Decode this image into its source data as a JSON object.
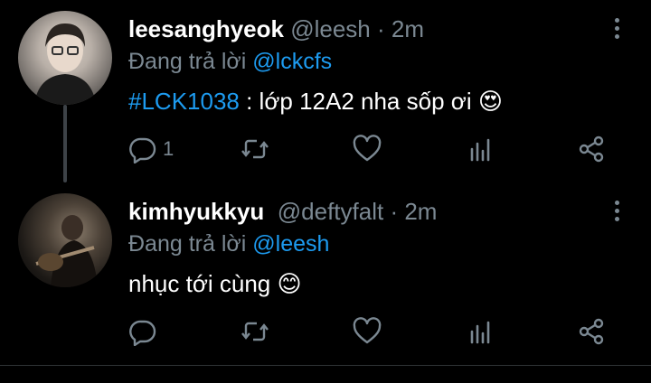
{
  "tweets": [
    {
      "display_name": "leesanghyeok",
      "handle": "@leesh",
      "separator": "·",
      "time": "2m",
      "reply_prefix": "Đang trả lời",
      "reply_to": "@lckcfs",
      "hashtag": "#LCK1038",
      "text": " : lớp 12A2 nha sốp ơi",
      "emoji": "😍",
      "reply_count": "1",
      "avatar_icon": "person-photo-avatar"
    },
    {
      "display_name": "kimhyukkyu",
      "handle": "@deftyfalt",
      "separator": "·",
      "time": "2m",
      "reply_prefix": "Đang trả lời",
      "reply_to": "@leesh",
      "text": "nhục tới cùng",
      "emoji": "😊",
      "reply_count": "",
      "avatar_icon": "guitarist-photo-avatar"
    }
  ],
  "colors": {
    "background": "#000000",
    "text": "#ffffff",
    "muted": "#7b8892",
    "accent": "#1d9bf0",
    "thread_line": "#3d4247"
  },
  "icons": [
    "reply-icon",
    "retweet-icon",
    "like-icon",
    "analytics-icon",
    "share-icon",
    "more-icon"
  ]
}
